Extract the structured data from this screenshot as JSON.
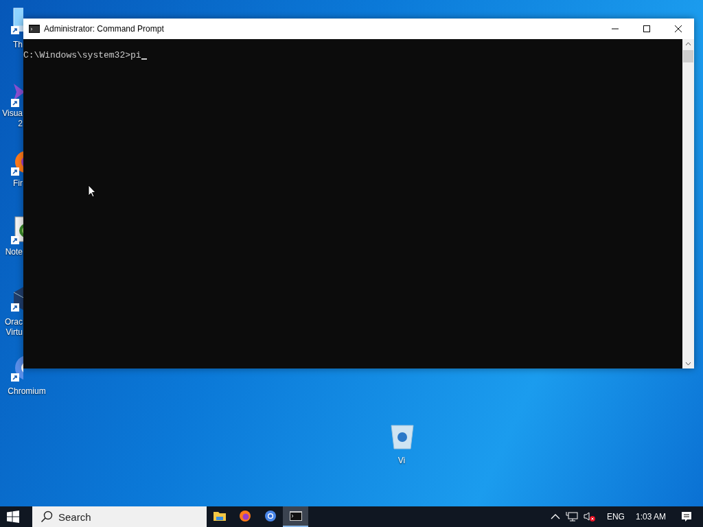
{
  "desktop": {
    "icons": [
      {
        "kind": "computer",
        "label_lines": [
          "Th"
        ]
      },
      {
        "kind": "visual-studio",
        "label_lines": [
          "Visua",
          "2"
        ]
      },
      {
        "kind": "firefox",
        "label_lines": [
          "Fir"
        ]
      },
      {
        "kind": "notepad",
        "label_lines": [
          "Note"
        ]
      },
      {
        "kind": "virtualbox",
        "label_lines": [
          "Orac",
          "Virtu"
        ]
      },
      {
        "kind": "chromium",
        "label_lines": [
          "Chromium"
        ]
      },
      {
        "kind": "recycle-bin",
        "label_lines": [
          "Vi"
        ]
      }
    ]
  },
  "window": {
    "title": "Administrator: Command Prompt",
    "console_lines": [
      "C:\\Windows\\system32>pi"
    ]
  },
  "taskbar": {
    "search": {
      "placeholder": "Search"
    },
    "apps": [
      {
        "kind": "folder",
        "selected": false
      },
      {
        "kind": "firefox",
        "selected": false
      },
      {
        "kind": "chromium",
        "selected": false
      },
      {
        "kind": "terminal",
        "selected": true
      }
    ],
    "language": "ENG",
    "time": "1:03 AM"
  }
}
